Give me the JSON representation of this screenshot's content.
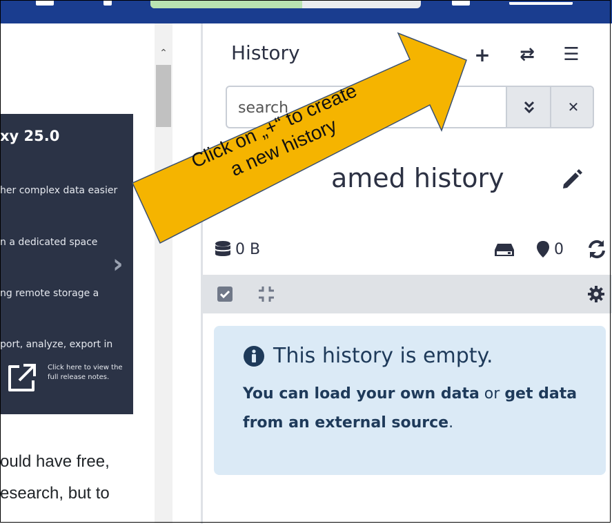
{
  "left_panel": {
    "banner": {
      "title": "xy 25.0",
      "lines": [
        "her complex data easier",
        "n a dedicated space",
        "ng remote storage a",
        "port, analyze, export in"
      ],
      "note": "Click here to view the full release notes."
    },
    "text_lines": [
      "ould have free,",
      "esearch, but to",
      "  "
    ]
  },
  "history_panel": {
    "title": "History",
    "buttons": {
      "new": "+",
      "switch": "⇄",
      "menu": "☰"
    },
    "search": {
      "placeholder": "search"
    },
    "history_name": "amed history",
    "stats": {
      "size": "0 B",
      "deleted_count": "0"
    },
    "empty": {
      "title": "This history is empty.",
      "link_load": "You can load your own data",
      "or": " or ",
      "link_get": "get data from an external source",
      "period": "."
    }
  },
  "annotation": {
    "line1": "Click on „+“ to create",
    "line2": "a new history"
  },
  "colors": {
    "topbar": "#1a3d8f",
    "callout": "#f5b400",
    "alert_bg": "#dbeaf6",
    "banner_bg": "#2b3346"
  }
}
